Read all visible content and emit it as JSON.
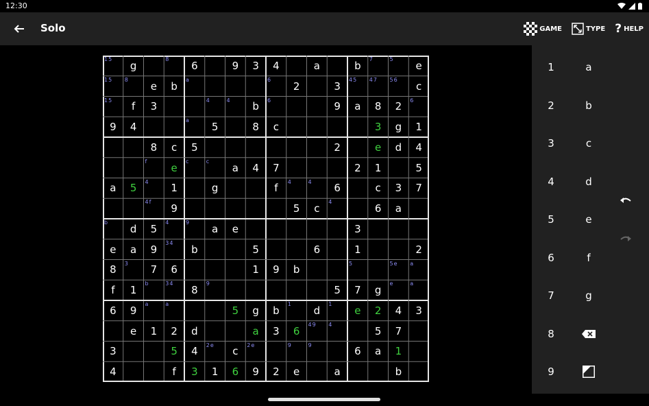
{
  "status": {
    "time": "12:30"
  },
  "toolbar": {
    "title": "Solo",
    "actions": [
      {
        "label": "GAME",
        "icon": "checkerboard-icon"
      },
      {
        "label": "TYPE",
        "icon": "resize-icon"
      },
      {
        "label": "HELP",
        "icon": "question-icon"
      }
    ]
  },
  "board": {
    "size": 16,
    "rows": [
      [
        "{15}",
        "g",
        "",
        "{8}",
        "6",
        "",
        "9",
        "3",
        "4",
        "",
        "a",
        "",
        "b",
        "{7}",
        "{5}",
        "e"
      ],
      [
        "{15}",
        "{8}",
        "e",
        "b",
        "{a}",
        "",
        "",
        "",
        "{6}",
        "2",
        "",
        "3",
        "{45}",
        "{47}",
        "{56}",
        "c"
      ],
      [
        "{15}",
        "f",
        "3",
        "",
        "",
        "{4}",
        "{4}",
        "b",
        "{6}",
        "",
        "",
        "9",
        "a",
        "8",
        "2",
        "{6}"
      ],
      [
        "9",
        "4",
        "",
        "",
        "{a}",
        "5",
        "",
        "8",
        "c",
        "",
        "",
        "",
        "",
        "*3",
        "g",
        "1"
      ],
      [
        "",
        "",
        "8",
        "c",
        "5",
        "",
        "",
        "",
        "",
        "",
        "",
        "2",
        "",
        "*e",
        "d",
        "4"
      ],
      [
        "",
        "",
        "{f}",
        "*e",
        "{c}",
        "{c}",
        "a",
        "4",
        "7",
        "",
        "",
        "",
        "2",
        "1",
        "",
        "5"
      ],
      [
        "a",
        "*5",
        "{4}",
        "1",
        "",
        "g",
        "",
        "",
        "f",
        "{4}",
        "{4}",
        "6",
        "",
        "c",
        "3",
        "7"
      ],
      [
        "",
        "",
        "{4f}",
        "9",
        "",
        "",
        "",
        "",
        "",
        "5",
        "c",
        "{4}",
        "",
        "6",
        "a",
        ""
      ],
      [
        "{b}",
        "d",
        "5",
        "{4}",
        "{9}",
        "a",
        "e",
        "",
        "",
        "",
        "",
        "",
        "3",
        "",
        "",
        ""
      ],
      [
        "e",
        "a",
        "9",
        "{34}",
        "b",
        "",
        "",
        "5",
        "",
        "",
        "6",
        "",
        "1",
        "",
        "",
        "2"
      ],
      [
        "8",
        "{3}",
        "7",
        "6",
        "",
        "",
        "",
        "1",
        "9",
        "b",
        "",
        "",
        "{5}",
        "",
        "{5e}",
        "{a}"
      ],
      [
        "f",
        "1",
        "{b}",
        "{34}",
        "8",
        "{9}",
        "",
        "",
        "",
        "",
        "",
        "5",
        "7",
        "g",
        "{e}",
        "{a}"
      ],
      [
        "6",
        "9",
        "{a}",
        "{a}",
        "",
        "",
        "*5",
        "g",
        "b",
        "{1}",
        "d",
        "{1}",
        "*e",
        "*2",
        "4",
        "3"
      ],
      [
        "",
        "e",
        "1",
        "2",
        "d",
        "",
        "",
        "*a",
        "3",
        "*6",
        "{49}",
        "{4}",
        "",
        "5",
        "7",
        ""
      ],
      [
        "3",
        "",
        "",
        "*5",
        "4",
        "{2e}",
        "c",
        "{2e}",
        "",
        "{9}",
        "{9}",
        "",
        "6",
        "a",
        "*1",
        ""
      ],
      [
        "4",
        "",
        "",
        "f",
        "*3",
        "1",
        "*6",
        "9",
        "2",
        "e",
        "",
        "a",
        "",
        "",
        "b",
        ""
      ]
    ]
  },
  "keypad": {
    "digits": [
      "1",
      "2",
      "3",
      "4",
      "5",
      "6",
      "7",
      "8",
      "9"
    ],
    "letters": [
      "a",
      "b",
      "c",
      "d",
      "e",
      "f",
      "g"
    ],
    "erase_icon": "backspace-icon",
    "pencil_icon": "pencil-mode-icon",
    "undo_icon": "undo-icon",
    "redo_icon": "redo-icon"
  },
  "colors": {
    "background": "#000000",
    "toolbar": "#212121",
    "given": "#ffffff",
    "user_entry": "#3fd13f",
    "pencil_note": "#8b8bf2"
  }
}
